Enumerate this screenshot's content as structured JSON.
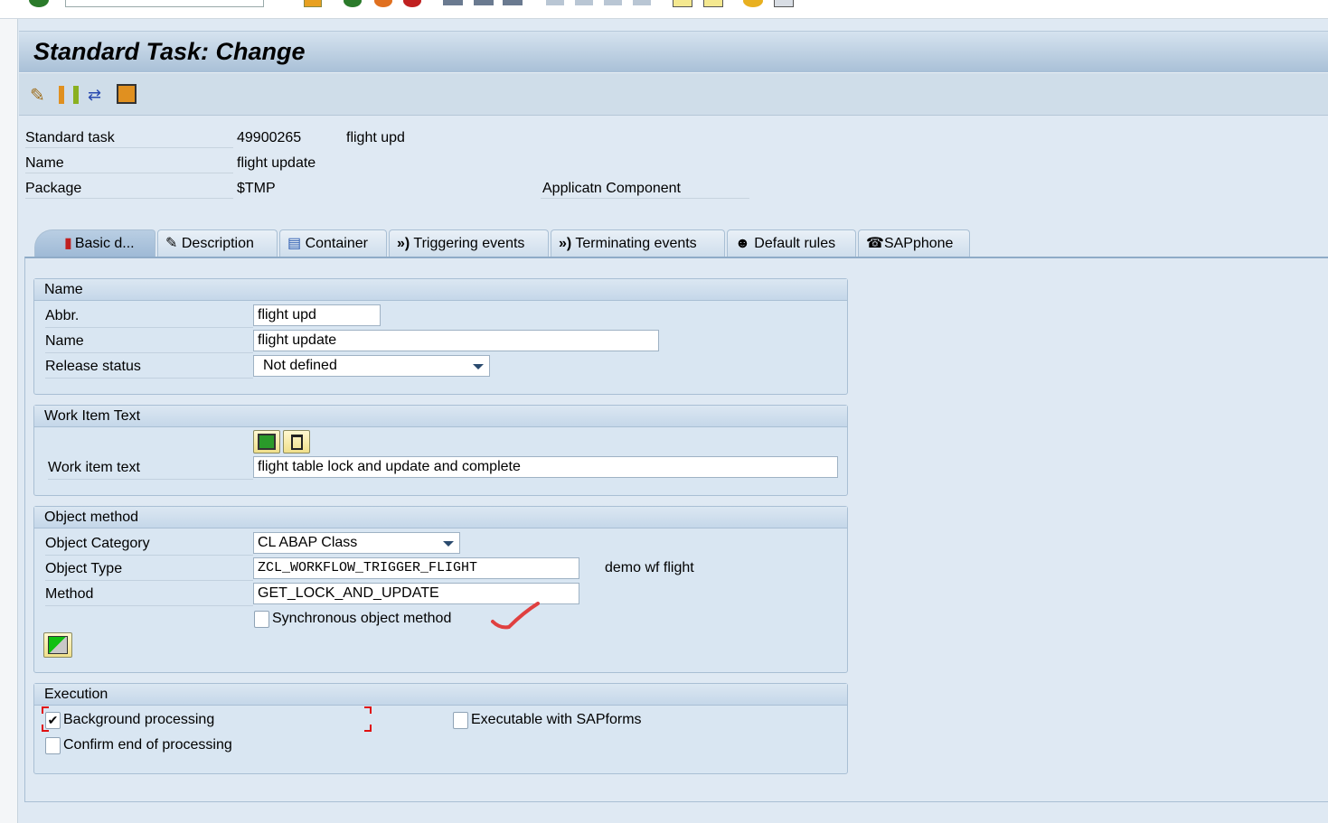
{
  "window": {
    "title": "Standard Task: Change"
  },
  "header": {
    "standard_task_label": "Standard task",
    "standard_task_id": "49900265",
    "standard_task_abbr": "flight upd",
    "name_label": "Name",
    "name_value": "flight update",
    "package_label": "Package",
    "package_value": "$TMP",
    "app_component_label": "Applicatn Component",
    "app_component_value": ""
  },
  "tabs": [
    {
      "label": "Basic d...",
      "icon": "basic-data-icon",
      "active": true
    },
    {
      "label": "Description",
      "icon": "description-icon"
    },
    {
      "label": "Container",
      "icon": "container-icon"
    },
    {
      "label": "Triggering events",
      "icon": "event-icon"
    },
    {
      "label": "Terminating events",
      "icon": "event-icon"
    },
    {
      "label": "Default rules",
      "icon": "default-rules-icon"
    },
    {
      "label": "SAPphone",
      "icon": "phone-icon"
    }
  ],
  "name_group": {
    "title": "Name",
    "abbr_label": "Abbr.",
    "abbr_value": "flight upd",
    "name_label": "Name",
    "name_value": "flight update",
    "release_label": "Release status",
    "release_value": "Not defined"
  },
  "work_item_group": {
    "title": "Work Item Text",
    "text_label": "Work item text",
    "text_value": "flight table lock and update and complete"
  },
  "object_method_group": {
    "title": "Object method",
    "category_label": "Object Category",
    "category_value": "CL ABAP Class",
    "type_label": "Object Type",
    "type_value": "ZCL_WORKFLOW_TRIGGER_FLIGHT",
    "type_desc": "demo wf flight",
    "method_label": "Method",
    "method_value": "GET_LOCK_AND_UPDATE",
    "synchronous_label": "Synchronous object method",
    "synchronous_checked": false
  },
  "execution_group": {
    "title": "Execution",
    "background_label": "Background processing",
    "background_checked": true,
    "confirm_label": "Confirm end of processing",
    "confirm_checked": false,
    "sapforms_label": "Executable with SAPforms",
    "sapforms_checked": false
  },
  "colors": {
    "annotation": "#e01010",
    "title_bar": "#a9c0d7",
    "background": "#dfe9f3"
  }
}
